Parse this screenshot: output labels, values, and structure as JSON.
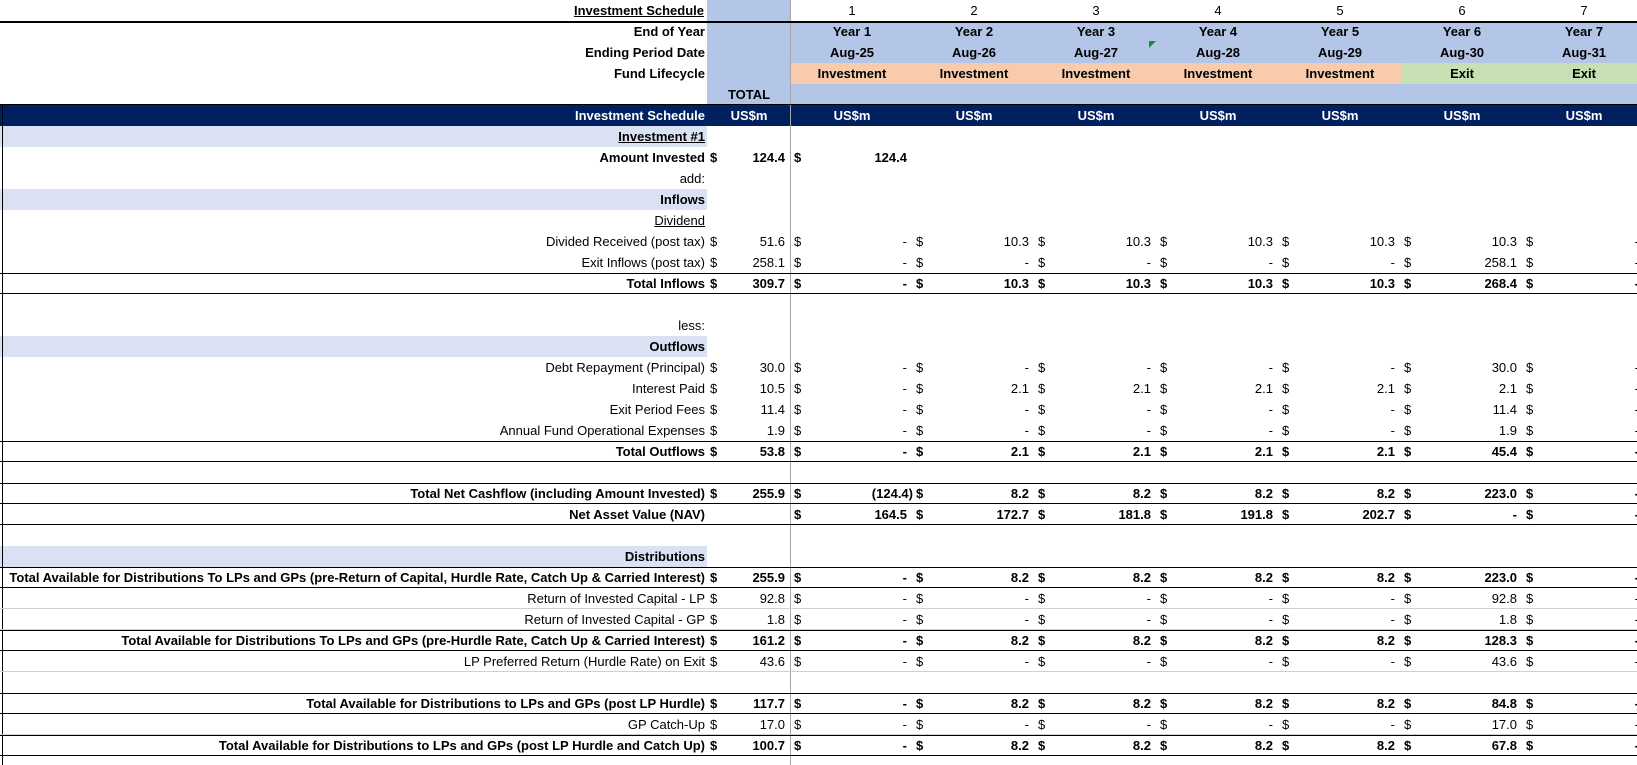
{
  "sheet": {
    "header": {
      "title": "Investment Schedule",
      "col_numbers": [
        "1",
        "2",
        "3",
        "4",
        "5",
        "6",
        "7"
      ],
      "end_of_year_label": "End of Year",
      "years": [
        "Year 1",
        "Year 2",
        "Year 3",
        "Year 4",
        "Year 5",
        "Year 6",
        "Year 7"
      ],
      "ending_period_label": "Ending Period Date",
      "dates": [
        "Aug-25",
        "Aug-26",
        "Aug-27",
        "Aug-28",
        "Aug-29",
        "Aug-30",
        "Aug-31"
      ],
      "fund_lifecycle_label": "Fund Lifecycle",
      "lifecycle": [
        "Investment",
        "Investment",
        "Investment",
        "Investment",
        "Investment",
        "Exit",
        "Exit"
      ],
      "total_label": "TOTAL",
      "band_title": "Investment Schedule",
      "unit": "US$m",
      "currency": "$"
    },
    "colors": {
      "navy": "#002060",
      "blue_header": "#b4c6e7",
      "section_fill": "#d9e1f2",
      "investment_fill": "#f8cbad",
      "exit_fill": "#c6e0b4",
      "comment_marker": "#1a8a3a"
    },
    "rows": {
      "investment_heading": "Investment #1",
      "amount_invested": {
        "label": "Amount Invested",
        "total": "124.4",
        "values": [
          "124.4",
          "",
          "",
          "",
          "",
          "",
          ""
        ]
      },
      "add_label": "add:",
      "inflows_heading": "Inflows",
      "dividend_heading": "Dividend",
      "dividend_received": {
        "label": "Divided Received (post tax)",
        "total": "51.6",
        "values": [
          "-",
          "10.3",
          "10.3",
          "10.3",
          "10.3",
          "10.3",
          "-"
        ]
      },
      "exit_inflows": {
        "label": "Exit Inflows (post tax)",
        "total": "258.1",
        "values": [
          "-",
          "-",
          "-",
          "-",
          "-",
          "258.1",
          "-"
        ]
      },
      "total_inflows": {
        "label": "Total Inflows",
        "total": "309.7",
        "values": [
          "-",
          "10.3",
          "10.3",
          "10.3",
          "10.3",
          "268.4",
          "-"
        ]
      },
      "less_label": "less:",
      "outflows_heading": "Outflows",
      "debt_repayment": {
        "label": "Debt Repayment (Principal)",
        "total": "30.0",
        "values": [
          "-",
          "-",
          "-",
          "-",
          "-",
          "30.0",
          "-"
        ]
      },
      "interest_paid": {
        "label": "Interest Paid",
        "total": "10.5",
        "values": [
          "-",
          "2.1",
          "2.1",
          "2.1",
          "2.1",
          "2.1",
          "-"
        ]
      },
      "exit_period_fees": {
        "label": "Exit Period Fees",
        "total": "11.4",
        "values": [
          "-",
          "-",
          "-",
          "-",
          "-",
          "11.4",
          "-"
        ]
      },
      "annual_fund_expenses": {
        "label": "Annual Fund Operational Expenses",
        "total": "1.9",
        "values": [
          "-",
          "-",
          "-",
          "-",
          "-",
          "1.9",
          "-"
        ]
      },
      "total_outflows": {
        "label": "Total Outflows",
        "total": "53.8",
        "values": [
          "-",
          "2.1",
          "2.1",
          "2.1",
          "2.1",
          "45.4",
          "-"
        ]
      },
      "total_net_cashflow": {
        "label": "Total Net Cashflow (including Amount Invested)",
        "total": "255.9",
        "values": [
          "(124.4)",
          "8.2",
          "8.2",
          "8.2",
          "8.2",
          "223.0",
          "-"
        ]
      },
      "nav": {
        "label": "Net Asset Value (NAV)",
        "total": "",
        "values": [
          "164.5",
          "172.7",
          "181.8",
          "191.8",
          "202.7",
          "-",
          "-"
        ]
      },
      "distributions_heading": "Distributions",
      "avail_pre_roc": {
        "label": "Total Available for Distributions To LPs and GPs (pre-Return of Capital, Hurdle Rate, Catch Up & Carried Interest)",
        "total": "255.9",
        "values": [
          "-",
          "8.2",
          "8.2",
          "8.2",
          "8.2",
          "223.0",
          "-"
        ]
      },
      "roc_lp": {
        "label": "Return of Invested Capital - LP",
        "total": "92.8",
        "values": [
          "-",
          "-",
          "-",
          "-",
          "-",
          "92.8",
          "-"
        ]
      },
      "roc_gp": {
        "label": "Return of Invested Capital - GP",
        "total": "1.8",
        "values": [
          "-",
          "-",
          "-",
          "-",
          "-",
          "1.8",
          "-"
        ]
      },
      "avail_pre_hurdle": {
        "label": "Total Available for Distributions To LPs and GPs (pre-Hurdle Rate, Catch Up & Carried Interest)",
        "total": "161.2",
        "values": [
          "-",
          "8.2",
          "8.2",
          "8.2",
          "8.2",
          "128.3",
          "-"
        ]
      },
      "lp_hurdle": {
        "label": "LP Preferred Return (Hurdle Rate) on Exit",
        "total": "43.6",
        "values": [
          "-",
          "-",
          "-",
          "-",
          "-",
          "43.6",
          "-"
        ]
      },
      "avail_post_hurdle": {
        "label": "Total Available for Distributions to LPs and GPs (post LP Hurdle)",
        "total": "117.7",
        "values": [
          "-",
          "8.2",
          "8.2",
          "8.2",
          "8.2",
          "84.8",
          "-"
        ]
      },
      "gp_catchup": {
        "label": "GP Catch-Up",
        "total": "17.0",
        "values": [
          "-",
          "-",
          "-",
          "-",
          "-",
          "17.0",
          "-"
        ]
      },
      "avail_post_catchup": {
        "label": "Total Available for Distributions to LPs and GPs (post LP Hurdle and Catch Up)",
        "total": "100.7",
        "values": [
          "-",
          "8.2",
          "8.2",
          "8.2",
          "8.2",
          "67.8",
          "-"
        ]
      }
    }
  }
}
